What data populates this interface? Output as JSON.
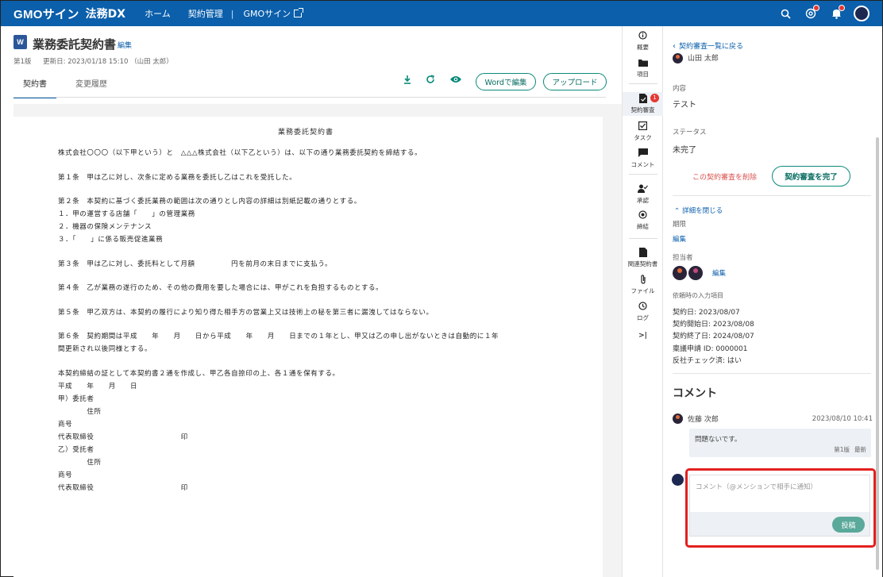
{
  "topbar": {
    "logo": "GMOサイン",
    "product": "法務DX",
    "nav": [
      "ホーム",
      "契約管理"
    ],
    "separator": "|",
    "external": "GMOサイン"
  },
  "document": {
    "title": "業務委託契約書",
    "edit_label": "編集",
    "version": "第1版",
    "updated": "更新日: 2023/01/18 15:10 （山田 太郎）",
    "tabs": [
      "契約書",
      "変更履歴"
    ],
    "word_edit_button": "Wordで編集",
    "upload_button": "アップロード"
  },
  "paper": {
    "title": "業務委託契約書",
    "lines": [
      "株式会社〇〇〇（以下甲という）と　△△△株式会社（以下乙という）は、以下の通り業務委託契約を締結する。",
      "",
      "第１条　甲は乙に対し、次条に定める業務を委託し乙はこれを受託した。",
      "",
      "第２条　本契約に基づく委託業務の範囲は次の通りとし内容の詳細は別紙記載の通りとする。",
      "１．甲の運営する店舗「　　」の管理業務",
      "２．機器の保険メンテナンス",
      "３．「　　」に係る販売促進業務",
      "",
      "第３条　甲は乙に対し、委託料として月額　　　　　円を前月の末日までに支払う。",
      "",
      "第４条　乙が業務の遂行のため、その他の費用を要した場合には、甲がこれを負担するものとする。",
      "",
      "第５条　甲乙双方は、本契約の履行により知り得た相手方の営業上又は技術上の秘を第三者に漏洩してはならない。",
      "",
      "第６条　契約期間は平成　　年　　月　　日から平成　　年　　月　　日までの１年とし、甲又は乙の申し出がないときは自動的に１年",
      "間更新され以後同様とする。",
      "",
      "本契約締結の証として本契約書２通を作成し、甲乙各自捺印の上、各１通を保有する。",
      "平成　　年　　月　　日",
      "甲）委託者",
      "　　　　住所",
      "商号",
      "代表取締役　　　　　　　　　　　　印",
      "乙）受託者",
      "　　　　住所",
      "商号",
      "代表取締役　　　　　　　　　　　　印"
    ]
  },
  "rail": {
    "items": [
      {
        "label": "概要"
      },
      {
        "label": "項目"
      },
      {
        "label": "契約審査",
        "badge": "1"
      },
      {
        "label": "タスク"
      },
      {
        "label": "コメント"
      },
      {
        "label": "承認"
      },
      {
        "label": "締結"
      },
      {
        "label": "関連契約書"
      },
      {
        "label": "ファイル"
      },
      {
        "label": "ログ"
      }
    ],
    "collapse": ">|"
  },
  "panel": {
    "back": "契約審査一覧に戻る",
    "partial_user": "山田 太郎",
    "content_label": "内容",
    "content_value": "テスト",
    "status_label": "ステータス",
    "status_value": "未完了",
    "delete_link": "この契約審査を削除",
    "complete_button": "契約審査を完了",
    "collapse_details": "詳細を閉じる",
    "deadline_label": "期限",
    "deadline_edit": "編集",
    "assignee_label": "担当者",
    "assignee_edit": "編集",
    "input_items_label": "依頼時の入力項目",
    "input_items": [
      "契約日: 2023/08/07",
      "契約開始日: 2023/08/08",
      "契約終了日: 2024/08/07",
      "稟議申請 ID: 0000001",
      "反社チェック済: はい"
    ],
    "comment_title": "コメント",
    "comment": {
      "author": "佐藤 次郎",
      "date": "2023/08/10 10:41",
      "text": "問題ないです。",
      "version": "第1版",
      "latest": "最新"
    },
    "comment_placeholder": "コメント（@メンションで相手に通知）",
    "post_button": "投稿"
  },
  "colors": {
    "brand": "#0b5fab",
    "accent": "#0b8a7a",
    "danger": "#d9534f",
    "highlight": "#e32020"
  }
}
